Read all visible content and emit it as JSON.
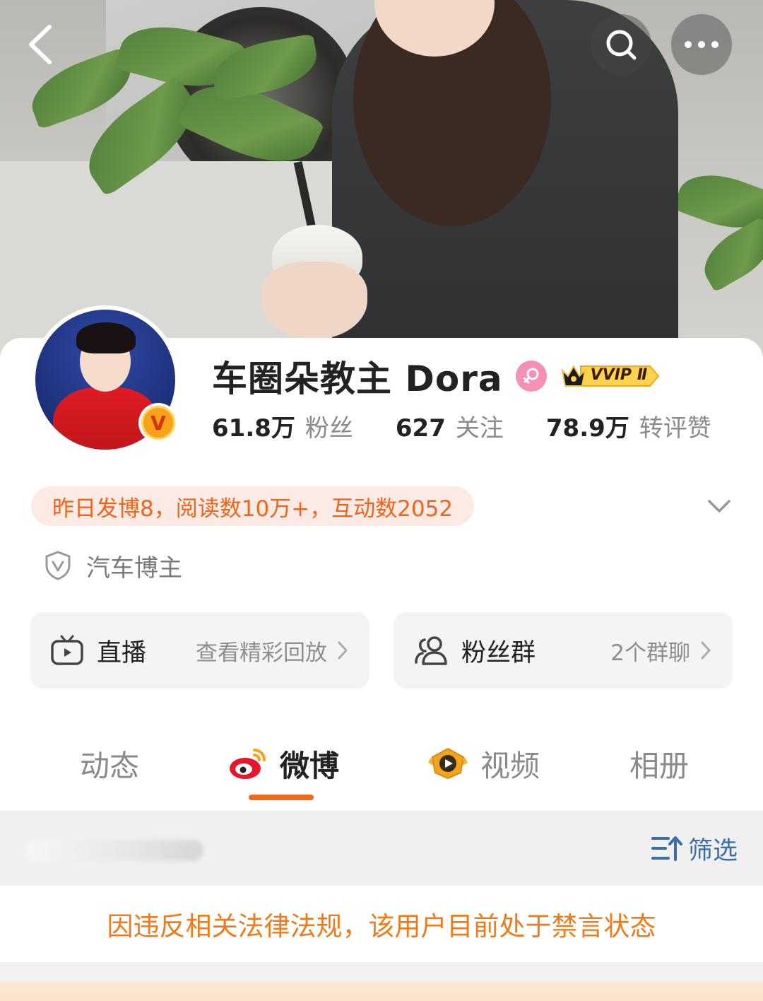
{
  "profile": {
    "name": "车圈朵教主 Dora",
    "vvip_label": "VVIP Ⅱ",
    "avatar_badge": "V"
  },
  "stats": [
    {
      "value": "61.8万",
      "label": "粉丝"
    },
    {
      "value": "627",
      "label": "关注"
    },
    {
      "value": "78.9万",
      "label": "转评赞"
    }
  ],
  "summary": "昨日发博8，阅读数10万+，互动数2052",
  "verification": "汽车博主",
  "entries": {
    "live": {
      "title": "直播",
      "sub": "查看精彩回放"
    },
    "fan_group": {
      "title": "粉丝群",
      "sub": "2个群聊"
    }
  },
  "tabs": [
    {
      "label": "动态",
      "icon": "none",
      "active": false
    },
    {
      "label": "微博",
      "icon": "weibo-icon",
      "active": true
    },
    {
      "label": "视频",
      "icon": "video-icon",
      "active": false
    },
    {
      "label": "相册",
      "icon": "none",
      "active": false
    }
  ],
  "filter_label": "筛选",
  "banned_notice": "因违反相关法律法规，该用户目前处于禁言状态",
  "colors": {
    "accent": "#f06a1d",
    "filter_blue": "#3a6ea5",
    "notice_orange": "#f07a1a",
    "summary_bg": "#fcebe4"
  },
  "icons": [
    "back-arrow-icon",
    "search-icon",
    "more-icon",
    "female-icon",
    "vvip-crown-icon",
    "verified-v-icon",
    "shield-icon",
    "expand-chevron-icon",
    "tv-icon",
    "group-icon",
    "chevron-right-icon",
    "weibo-icon",
    "video-icon",
    "filter-icon"
  ]
}
